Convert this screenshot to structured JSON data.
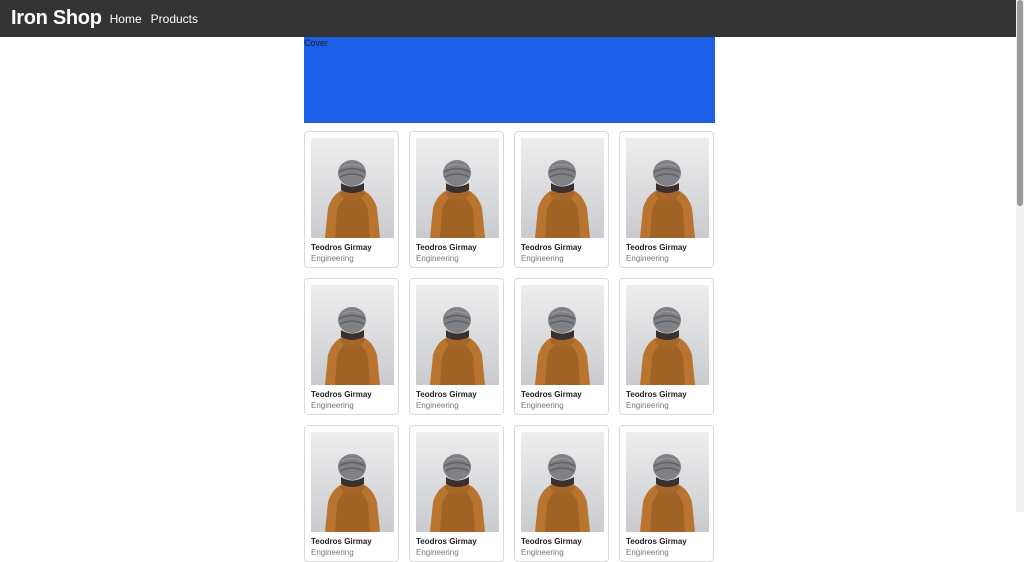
{
  "navbar": {
    "brand": "Iron Shop",
    "links": [
      {
        "label": "Home"
      },
      {
        "label": "Products"
      }
    ]
  },
  "cover": {
    "label": "Cover",
    "color": "#1a5fe6"
  },
  "cards": [
    {
      "name": "Teodros Girmay",
      "department": "Engineering"
    },
    {
      "name": "Teodros Girmay",
      "department": "Engineering"
    },
    {
      "name": "Teodros Girmay",
      "department": "Engineering"
    },
    {
      "name": "Teodros Girmay",
      "department": "Engineering"
    },
    {
      "name": "Teodros Girmay",
      "department": "Engineering"
    },
    {
      "name": "Teodros Girmay",
      "department": "Engineering"
    },
    {
      "name": "Teodros Girmay",
      "department": "Engineering"
    },
    {
      "name": "Teodros Girmay",
      "department": "Engineering"
    },
    {
      "name": "Teodros Girmay",
      "department": "Engineering"
    },
    {
      "name": "Teodros Girmay",
      "department": "Engineering"
    },
    {
      "name": "Teodros Girmay",
      "department": "Engineering"
    },
    {
      "name": "Teodros Girmay",
      "department": "Engineering"
    }
  ]
}
